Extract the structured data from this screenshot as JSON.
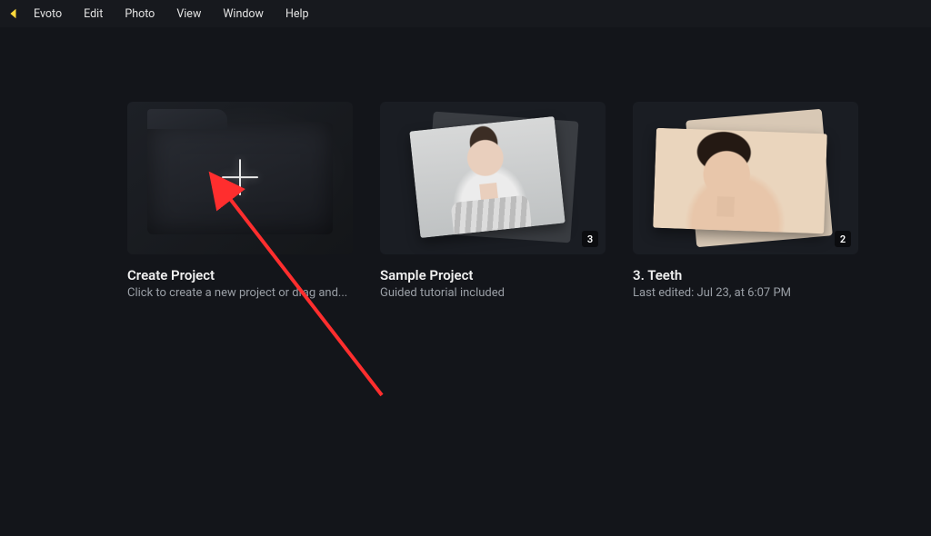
{
  "app": {
    "name": "Evoto"
  },
  "menu": {
    "items": [
      {
        "label": "Evoto"
      },
      {
        "label": "Edit"
      },
      {
        "label": "Photo"
      },
      {
        "label": "View"
      },
      {
        "label": "Window"
      },
      {
        "label": "Help"
      }
    ]
  },
  "cards": {
    "create": {
      "title": "Create Project",
      "subtitle": "Click to create a new project or drag and..."
    },
    "project1": {
      "title": "Sample Project",
      "subtitle": "Guided tutorial included",
      "count": "3"
    },
    "project2": {
      "title": "3. Teeth",
      "subtitle": "Last edited: Jul 23, at 6:07 PM",
      "count": "2"
    }
  },
  "annotation": {
    "arrow_color": "#ff2e2e"
  }
}
